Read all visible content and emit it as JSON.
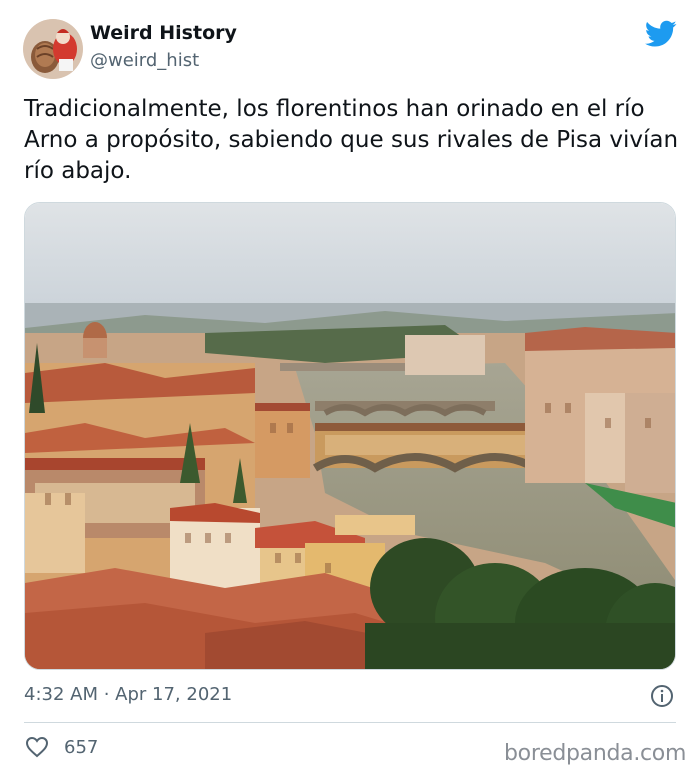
{
  "tweet": {
    "display_name": "Weird History",
    "handle": "@weird_hist",
    "text": "Tradicionalmente, los florentinos han orinado en el río Arno a propósito, sabiendo que sus rivales de Pisa vivían río abajo.",
    "timestamp": "4:32 AM · Apr 17, 2021",
    "like_count": "657"
  },
  "icons": {
    "logo": "twitter-bird-icon",
    "info": "info-icon",
    "like": "heart-icon"
  },
  "colors": {
    "brand": "#1d9bf0",
    "text": "#0f1419",
    "secondary": "#536471",
    "border": "#cfd9de"
  },
  "watermark": "boredpanda.com"
}
